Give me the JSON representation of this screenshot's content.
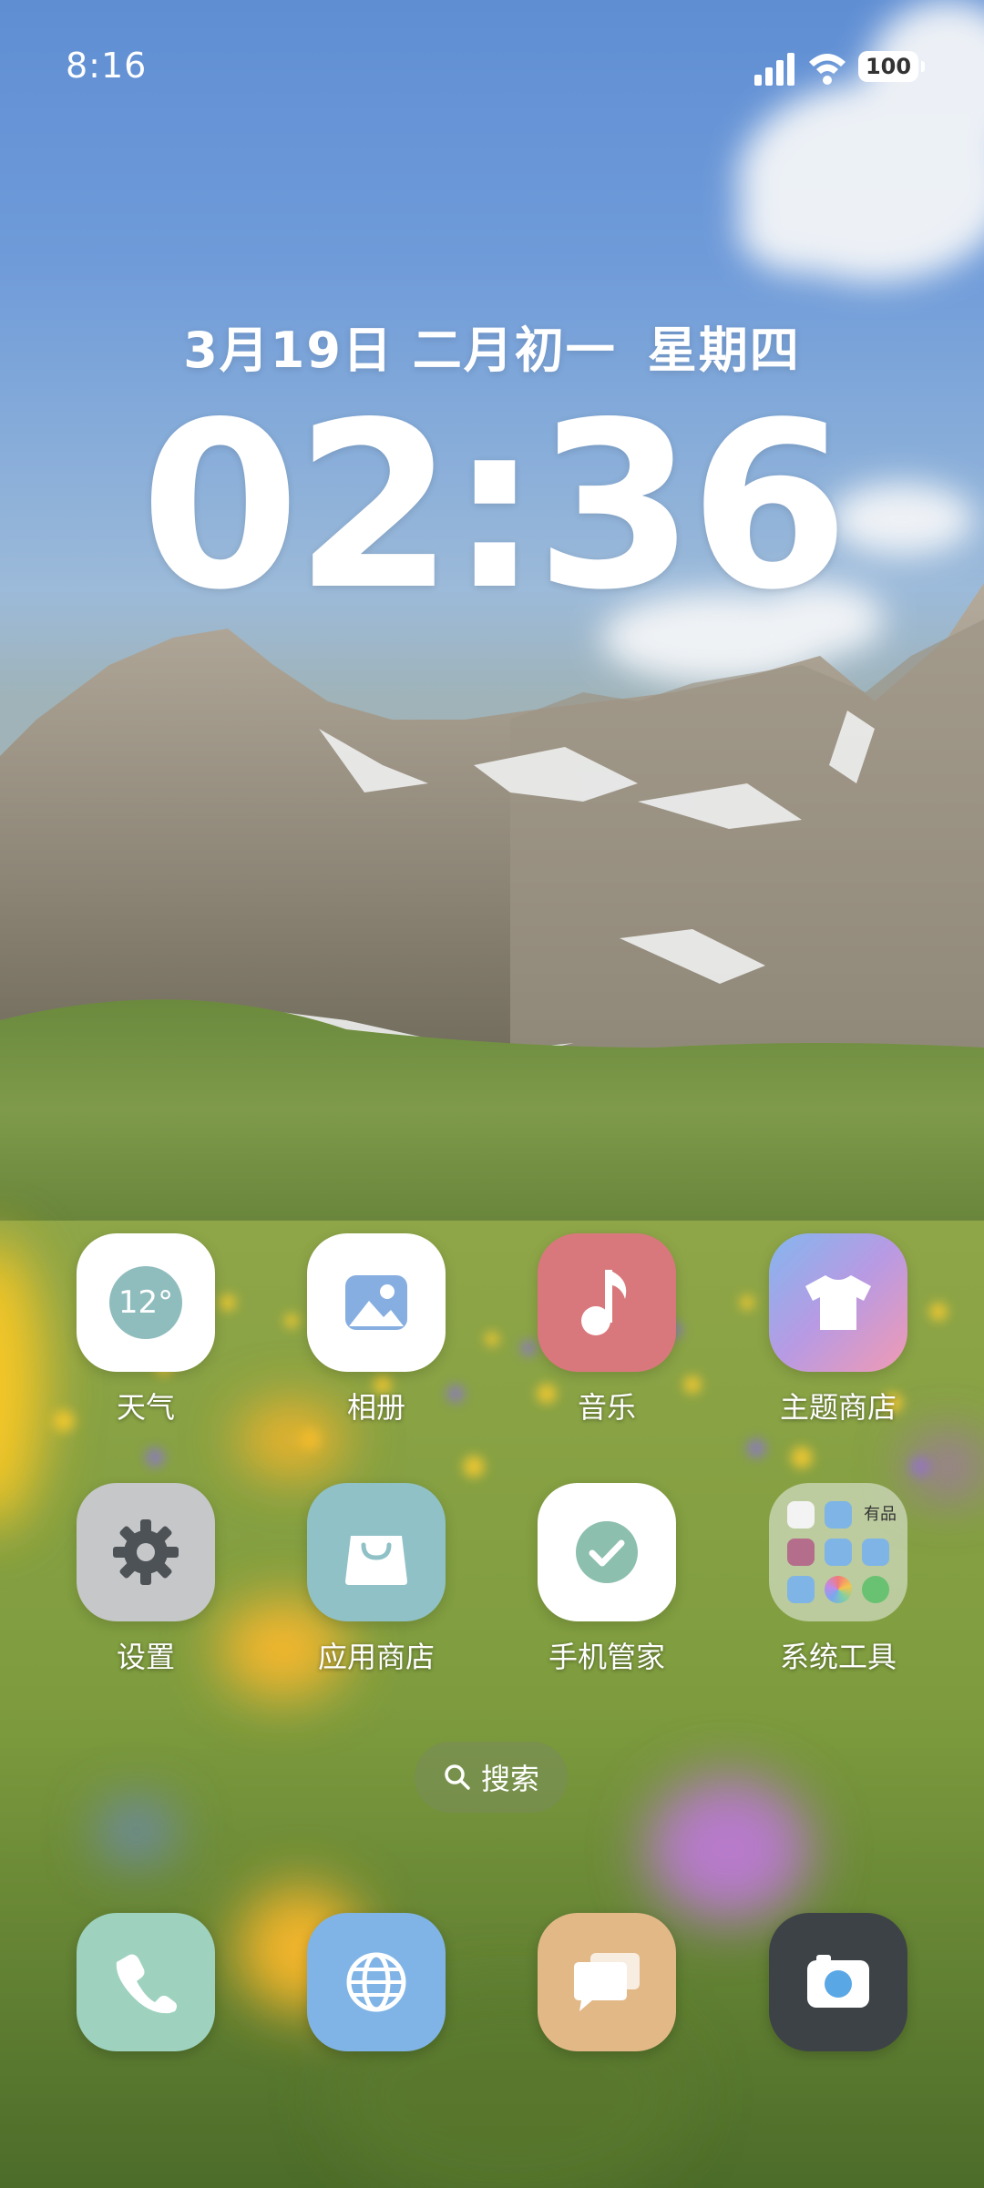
{
  "status_bar": {
    "time": "8:16",
    "battery": "100"
  },
  "widget": {
    "date": "3月19日 二月初一",
    "weekday": "星期四",
    "clock": "02:36"
  },
  "apps": {
    "weather": {
      "label": "天气",
      "temperature": "12°"
    },
    "gallery": {
      "label": "相册"
    },
    "music": {
      "label": "音乐"
    },
    "themes": {
      "label": "主题商店"
    },
    "settings": {
      "label": "设置"
    },
    "app_store": {
      "label": "应用商店"
    },
    "security": {
      "label": "手机管家"
    },
    "system_tools": {
      "label": "系统工具",
      "mini_text": "有品"
    }
  },
  "search": {
    "label": "搜索"
  },
  "dock": [
    "phone",
    "browser",
    "messages",
    "camera"
  ],
  "colors": {
    "weather_tile": "#ffffff",
    "music_tile": "#d9787c",
    "app_store_tile": "#8fc1c6",
    "phone_tile": "#9ed2bf",
    "browser_tile": "#80b4e6",
    "messages_tile": "#e3b887",
    "camera_tile": "#3d4247"
  }
}
